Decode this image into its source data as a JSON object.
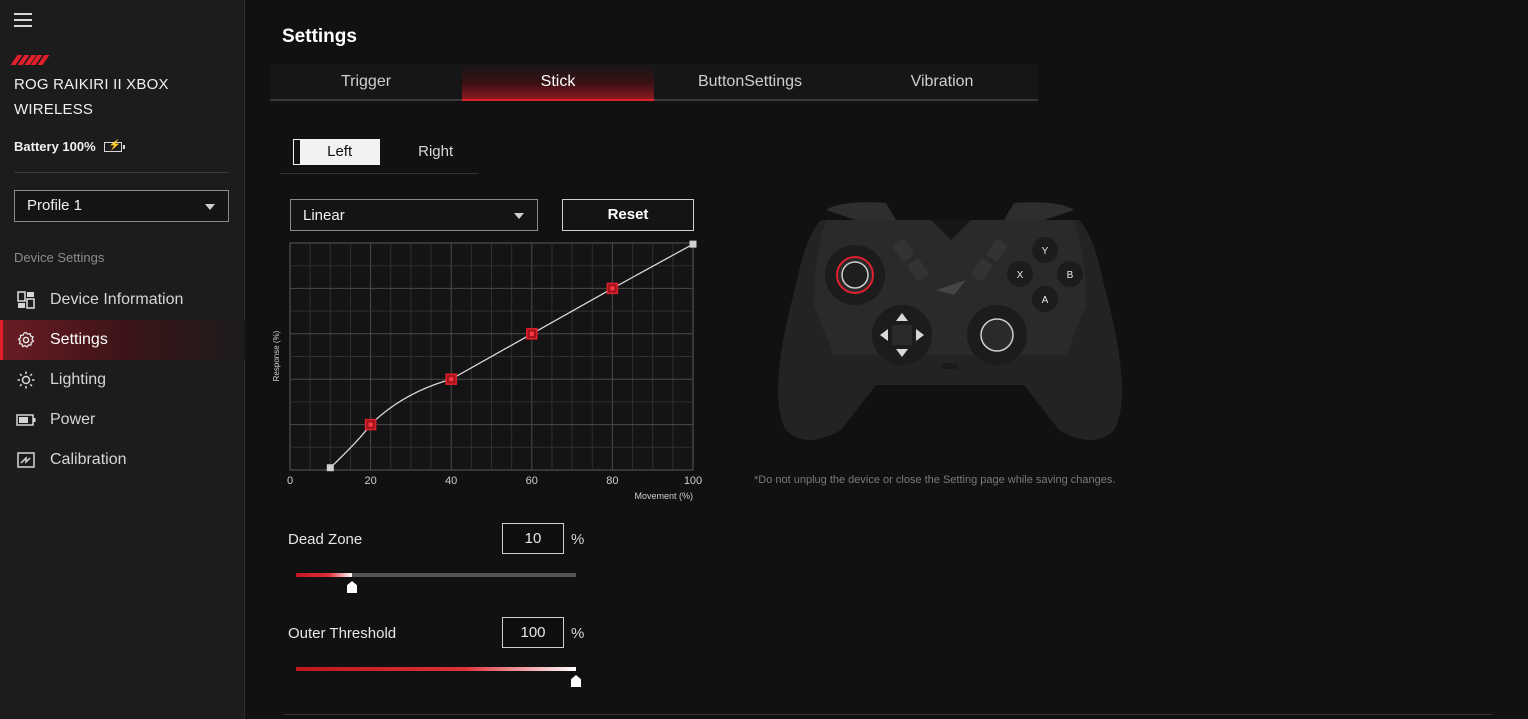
{
  "sidebar": {
    "device_name": "ROG RAIKIRI II XBOX WIRELESS",
    "battery_label": "Battery 100%",
    "battery_icon": "battery-charging-icon",
    "profile": "Profile 1",
    "section_label": "Device Settings",
    "items": [
      {
        "label": "Device Information",
        "icon": "grid-icon"
      },
      {
        "label": "Settings",
        "icon": "gear-icon",
        "active": true
      },
      {
        "label": "Lighting",
        "icon": "sun-icon"
      },
      {
        "label": "Power",
        "icon": "battery-icon"
      },
      {
        "label": "Calibration",
        "icon": "calibration-icon"
      }
    ]
  },
  "main": {
    "title": "Settings",
    "tabs": [
      {
        "label": "Trigger"
      },
      {
        "label": "Stick",
        "active": true
      },
      {
        "label": "ButtonSettings"
      },
      {
        "label": "Vibration"
      }
    ],
    "stick_side": {
      "left": "Left",
      "right": "Right",
      "selected": "Left"
    },
    "curve_type": "Linear",
    "reset_label": "Reset",
    "dead_zone": {
      "label": "Dead Zone",
      "value": "10",
      "unit": "%"
    },
    "outer_threshold": {
      "label": "Outer Threshold",
      "value": "100",
      "unit": "%"
    },
    "note": "*Do not unplug the device or close the Setting page while saving changes.",
    "controller_buttons": {
      "y": "Y",
      "x": "X",
      "b": "B",
      "a": "A"
    }
  },
  "colors": {
    "accent": "#e0202d",
    "background": "#111111",
    "sidebar": "#1c1c1c"
  },
  "chart_data": {
    "type": "line",
    "xlabel": "Movement (%)",
    "ylabel": "Response (%)",
    "x_ticks": [
      "0",
      "20",
      "40",
      "60",
      "80",
      "100"
    ],
    "xlim": [
      0,
      100
    ],
    "ylim": [
      0,
      100
    ],
    "grid": true,
    "points": [
      {
        "x": 10,
        "y": 1,
        "type": "endpoint"
      },
      {
        "x": 20,
        "y": 20,
        "type": "control"
      },
      {
        "x": 40,
        "y": 40,
        "type": "control"
      },
      {
        "x": 60,
        "y": 60,
        "type": "control"
      },
      {
        "x": 80,
        "y": 80,
        "type": "control"
      },
      {
        "x": 100,
        "y": 99.5,
        "type": "endpoint"
      }
    ]
  }
}
